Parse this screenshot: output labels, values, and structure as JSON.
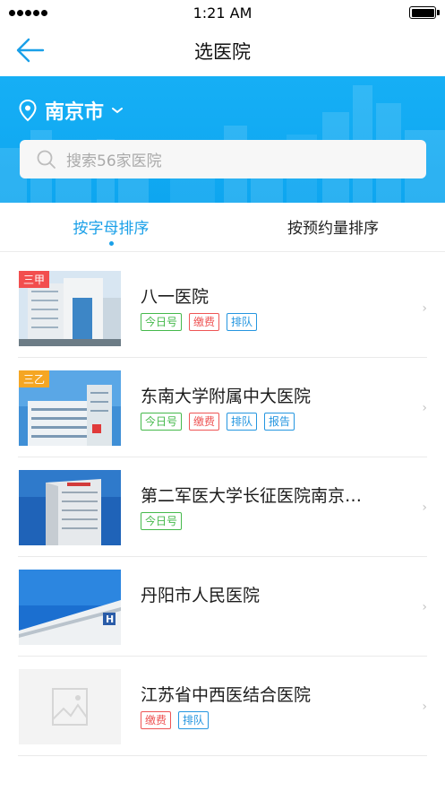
{
  "status_bar": {
    "time": "1:21 AM"
  },
  "nav": {
    "title": "选医院"
  },
  "location": {
    "city": "南京市"
  },
  "search": {
    "placeholder": "搜索56家医院"
  },
  "tabs": [
    {
      "label": "按字母排序",
      "active": true
    },
    {
      "label": "按预约量排序",
      "active": false
    }
  ],
  "hospitals": [
    {
      "name": "八一医院",
      "rank": "三甲",
      "rank_color": "#f24e4e",
      "image": "hospital-photo",
      "tags": [
        "今日号",
        "缴费",
        "排队"
      ]
    },
    {
      "name": "东南大学附属中大医院",
      "rank": "三乙",
      "rank_color": "#f5a623",
      "image": "hospital-photo",
      "tags": [
        "今日号",
        "缴费",
        "排队",
        "报告"
      ]
    },
    {
      "name": "第二军医大学长征医院南京…",
      "rank": "",
      "image": "hospital-photo",
      "tags": [
        "今日号"
      ]
    },
    {
      "name": "丹阳市人民医院",
      "rank": "",
      "image": "hospital-photo",
      "tags": []
    },
    {
      "name": "江苏省中西医结合医院",
      "rank": "",
      "image": "image-placeholder-icon",
      "tags": [
        "缴费",
        "排队"
      ]
    }
  ],
  "tag_colors": {
    "今日号": "#45b94b",
    "缴费": "#ee5555",
    "排队": "#2596e0",
    "报告": "#2596e0"
  },
  "accent": "#1aa0e8",
  "row_arrow": "›"
}
